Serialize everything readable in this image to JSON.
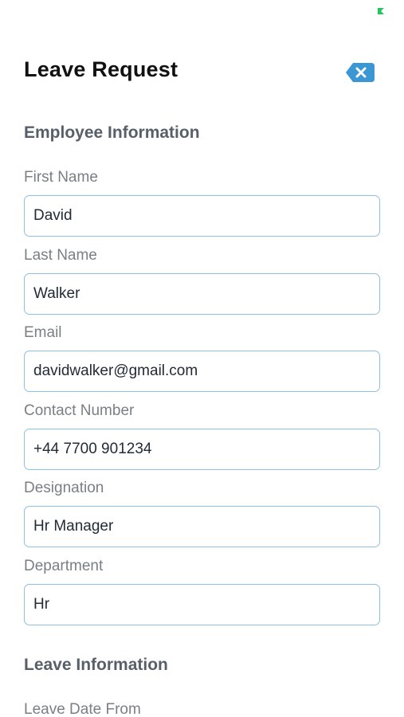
{
  "colors": {
    "accent": "#3a97d4",
    "input_border": "#8fbfe2",
    "status_indicator": "#22c55e"
  },
  "header": {
    "title": "Leave Request",
    "close_icon": "close-icon"
  },
  "sections": {
    "employee": "Employee Information",
    "leave": "Leave Information"
  },
  "fields": {
    "first_name": {
      "label": "First Name",
      "value": "David"
    },
    "last_name": {
      "label": "Last Name",
      "value": "Walker"
    },
    "email": {
      "label": "Email",
      "value": "davidwalker@gmail.com"
    },
    "contact_number": {
      "label": "Contact Number",
      "value": "+44 7700 901234"
    },
    "designation": {
      "label": "Designation",
      "value": "Hr Manager"
    },
    "department": {
      "label": "Department",
      "value": "Hr"
    },
    "leave_date_from": {
      "label": "Leave Date From"
    }
  }
}
